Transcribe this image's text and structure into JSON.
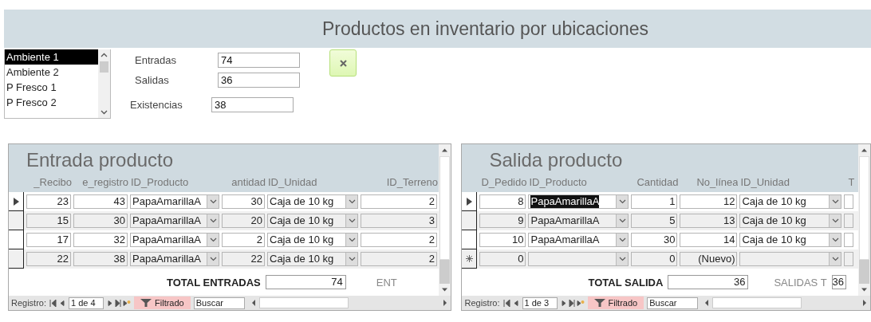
{
  "title": "Productos en inventario por ubicaciones",
  "locations": [
    {
      "label": "Ambiente 1",
      "selected": true
    },
    {
      "label": "Ambiente 2",
      "selected": false
    },
    {
      "label": "P Fresco 1",
      "selected": false
    },
    {
      "label": "P Fresco 2",
      "selected": false
    }
  ],
  "summary": [
    {
      "label": "Entradas",
      "value": "74"
    },
    {
      "label": "Salidas",
      "value": "36"
    },
    {
      "label": "Existencias",
      "value": "38"
    }
  ],
  "subforms": [
    {
      "title": "Entrada producto",
      "columns": [
        {
          "label": "_Recibo",
          "kind": "number"
        },
        {
          "label": "e_registro",
          "kind": "number"
        },
        {
          "label": "ID_Producto",
          "kind": "combo"
        },
        {
          "label": "antidad",
          "kind": "number"
        },
        {
          "label": "ID_Unidad",
          "kind": "combo"
        },
        {
          "label": "ID_Terreno",
          "kind": "number"
        }
      ],
      "rows": [
        {
          "kind": "record",
          "current": true,
          "cells": [
            "23",
            "43",
            "PapaAmarillaA",
            "30",
            "Caja de 10 kg",
            "2"
          ]
        },
        {
          "kind": "record",
          "current": false,
          "cells": [
            "15",
            "30",
            "PapaAmarillaA",
            "20",
            "Caja de 10 kg",
            "3"
          ]
        },
        {
          "kind": "record",
          "current": false,
          "cells": [
            "17",
            "32",
            "PapaAmarillaA",
            "2",
            "Caja de 10 kg",
            "2"
          ]
        },
        {
          "kind": "record",
          "current": false,
          "cells": [
            "22",
            "38",
            "PapaAmarillaA",
            "22",
            "Caja de 10 kg",
            "2"
          ]
        }
      ],
      "total_label": "TOTAL ENTRADAS",
      "total": "74",
      "extra_label": "ENT",
      "nav": {
        "label": "Registro:",
        "position": "1 de 4",
        "filter": "Filtrado",
        "search": "Buscar"
      }
    },
    {
      "title": "Salida producto",
      "columns": [
        {
          "label": "D_Pedido",
          "kind": "number"
        },
        {
          "label": "ID_Producto",
          "kind": "combo"
        },
        {
          "label": "Cantidad",
          "kind": "number"
        },
        {
          "label": "No_línea",
          "kind": "number"
        },
        {
          "label": "ID_Unidad",
          "kind": "combo"
        },
        {
          "label": "T",
          "kind": "number"
        }
      ],
      "rows": [
        {
          "kind": "record",
          "current": true,
          "product_selected": true,
          "cells": [
            "8",
            "PapaAmarillaA",
            "1",
            "12",
            "Caja de 10 kg",
            null
          ]
        },
        {
          "kind": "record",
          "current": false,
          "product_selected": false,
          "cells": [
            "9",
            "PapaAmarillaA",
            "5",
            "13",
            "Caja de 10 kg",
            null
          ]
        },
        {
          "kind": "record",
          "current": false,
          "product_selected": false,
          "cells": [
            "10",
            "PapaAmarillaA",
            "30",
            "14",
            "Caja de 10 kg",
            null
          ]
        },
        {
          "kind": "new",
          "cells": [
            "0",
            null,
            "0",
            "(Nuevo)",
            null,
            null
          ]
        }
      ],
      "total_label": "TOTAL SALIDA",
      "total": "36",
      "extra_label": "SALIDAS T",
      "extra_value": "36",
      "nav": {
        "label": "Registro:",
        "position": "1 de 3",
        "filter": "Filtrado",
        "search": "Buscar"
      }
    }
  ]
}
